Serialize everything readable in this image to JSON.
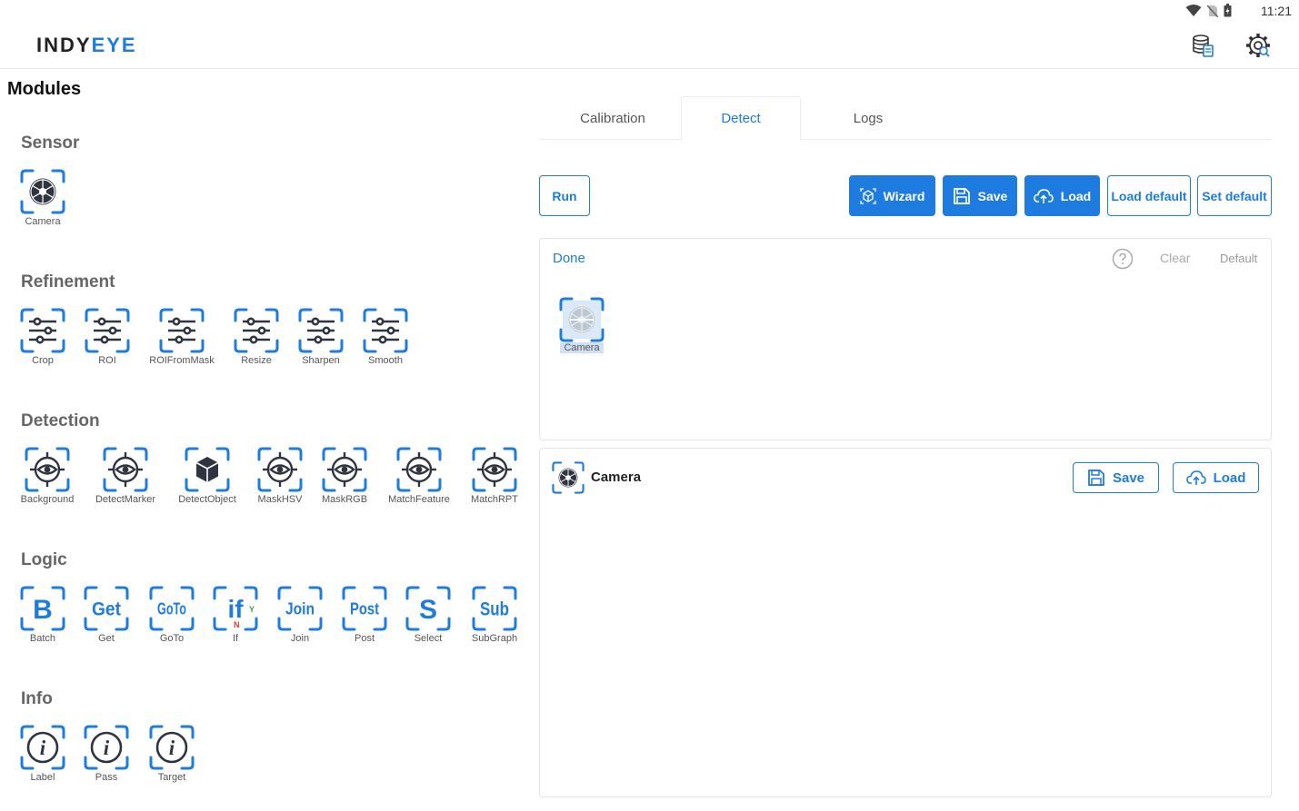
{
  "status": {
    "time": "11:21"
  },
  "app": {
    "logo_part1": "INDY",
    "logo_part2": "EYE"
  },
  "modules_title": "Modules",
  "sections": {
    "sensor": {
      "title": "Sensor",
      "items": [
        "Camera"
      ]
    },
    "refinement": {
      "title": "Refinement",
      "items": [
        "Crop",
        "ROI",
        "ROIFromMask",
        "Resize",
        "Sharpen",
        "Smooth"
      ]
    },
    "detection": {
      "title": "Detection",
      "items": [
        "Background",
        "DetectMarker",
        "DetectObject",
        "MaskHSV",
        "MaskRGB",
        "MatchFeature",
        "MatchRPT"
      ]
    },
    "logic": {
      "title": "Logic",
      "items": [
        "Batch",
        "Get",
        "GoTo",
        "If",
        "Join",
        "Post",
        "Select",
        "SubGraph"
      ],
      "glyphs": [
        "B",
        "Get",
        "GoTo",
        "if",
        "Join",
        "Post",
        "S",
        "Sub"
      ],
      "if_yes": "Y",
      "if_no": "N"
    },
    "info": {
      "title": "Info",
      "items": [
        "Label",
        "Pass",
        "Target"
      ]
    }
  },
  "tabs": [
    "Calibration",
    "Detect",
    "Logs"
  ],
  "toolbar": {
    "run": "Run",
    "wizard": "Wizard",
    "save": "Save",
    "load": "Load",
    "load_default": "Load default",
    "set_default": "Set default"
  },
  "graph_panel": {
    "status": "Done",
    "clear": "Clear",
    "default": "Default",
    "node_label": "Camera"
  },
  "detail_panel": {
    "title": "Camera",
    "save": "Save",
    "load": "Load"
  },
  "colors": {
    "accent": "#1e7be0",
    "dark_icon": "#2f3540",
    "no_red": "#e53935",
    "yes_green": "#43a047"
  }
}
